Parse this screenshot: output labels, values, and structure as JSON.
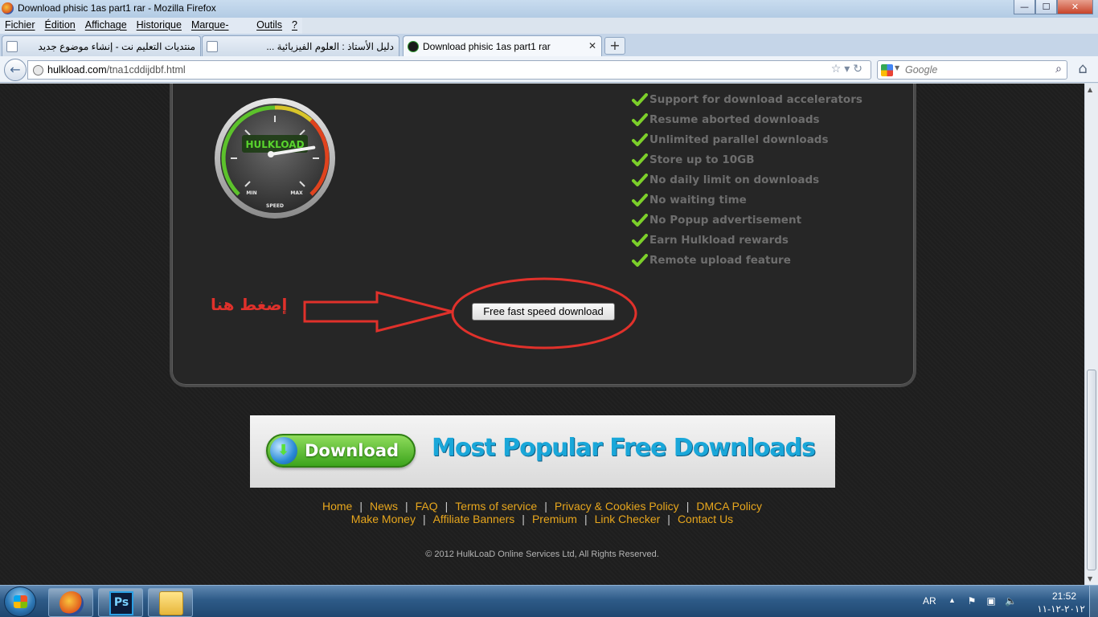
{
  "window": {
    "title": "Download phisic 1as part1 rar - Mozilla Firefox",
    "minimize": "—",
    "maximize": "☐",
    "close": "✕"
  },
  "menu": [
    "Fichier",
    "Édition",
    "Affichage",
    "Historique",
    "Marque-pages",
    "Outils",
    "?"
  ],
  "tabs": [
    {
      "label": "منتديات التعليم نت - إنشاء موضوع جديد"
    },
    {
      "label": "دليل الأستاذ : العلوم الفيزيائية ..."
    },
    {
      "label": "Download phisic 1as part1 rar",
      "close": "✕"
    }
  ],
  "newtab": "+",
  "nav": {
    "back": "←",
    "url_domain": "hulkload.com",
    "url_path": "/tna1cddijdbf.html",
    "url_icons": "☆▾↻",
    "search_placeholder": "Google",
    "search_icon": "⌕",
    "home": "⌂"
  },
  "page": {
    "gauge": {
      "min": "MIN",
      "max": "MAX",
      "label": "SPEED",
      "logo": "HULKLOAD",
      "level": 0.8
    },
    "features": [
      "Support for download accelerators",
      "Resume aborted downloads",
      "Unlimited parallel downloads",
      "Store up to 10GB",
      "No daily limit on downloads",
      "No waiting time",
      "No Popup advertisement",
      "Earn Hulkload rewards",
      "Remote upload feature"
    ],
    "annotation_text": "إضغط هنا",
    "download_button": "Free fast speed download",
    "banner": {
      "button": "Download",
      "headline": "Most Popular Free Downloads"
    },
    "footer_row1": [
      "Home",
      "News",
      "FAQ",
      "Terms of service",
      "Privacy & Cookies Policy",
      "DMCA Policy"
    ],
    "footer_row2": [
      "Make Money",
      "Affiliate Banners",
      "Premium",
      "Link Checker",
      "Contact Us"
    ],
    "footer_separator": "|",
    "copyright": "© 2012 HulkLoaD Online Services Ltd, All Rights Reserved."
  },
  "taskbar": {
    "ps_label": "Ps",
    "lang": "AR",
    "tray_up": "▲",
    "time": "21:52",
    "date": "٢٠١٢-١٢-١١"
  },
  "colors": {
    "accent_link": "#e7a61d",
    "annotation_red": "#e0312b",
    "check_green": "#7ccf2a"
  }
}
